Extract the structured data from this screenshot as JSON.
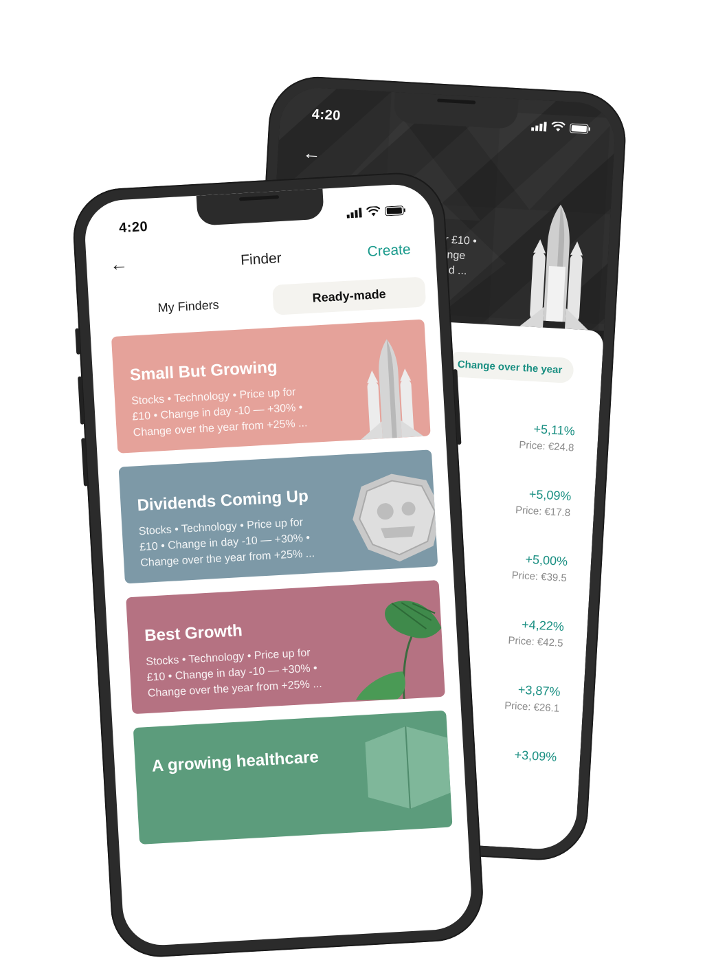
{
  "back_screen": {
    "time": "4:20",
    "partial_description_lines": [
      "for £10 •",
      "nange",
      "lend ..."
    ],
    "filter_chip_label": "Change over the year",
    "stocks": [
      {
        "change": "+5,11%",
        "price": "Price: €24.8"
      },
      {
        "change": "+5,09%",
        "price": "Price: €17.8"
      },
      {
        "change": "+5,00%",
        "price": "Price: €39.5"
      },
      {
        "change": "+4,22%",
        "price": "Price: €42.5"
      },
      {
        "change": "+3,87%",
        "price": "Price: €26.1"
      },
      {
        "change": "+3,09%",
        "price": ""
      }
    ]
  },
  "front_screen": {
    "time": "4:20",
    "header": {
      "title": "Finder",
      "create_label": "Create"
    },
    "tabs": [
      {
        "label": "My Finders",
        "active": false
      },
      {
        "label": "Ready-made",
        "active": true
      }
    ],
    "cards": [
      {
        "title": "Small But Growing",
        "lines": [
          "Stocks • Technology • Price up for",
          "£10 • Change in day -10 — +30% •",
          "Change over the year from +25% ..."
        ],
        "color": "#e5a29a",
        "art": "rocket"
      },
      {
        "title": "Dividends Coming Up",
        "lines": [
          "Stocks • Technology • Price up for",
          "£10 • Change in day -10 — +30% •",
          "Change over the year from +25% ..."
        ],
        "color": "#7d99a7",
        "art": "coin"
      },
      {
        "title": "Best Growth",
        "lines": [
          "Stocks • Technology • Price up for",
          "£10 • Change in day -10 — +30% •",
          "Change over the year from +25% ..."
        ],
        "color": "#b57282",
        "art": "plant"
      },
      {
        "title": "A growing healthcare",
        "lines": [],
        "color": "#5c9c7c",
        "art": "box"
      }
    ]
  },
  "colors": {
    "accent": "#1a9a8c",
    "phone_frame": "#2b2b2b",
    "back_screen_bg": "#1f1f1f"
  }
}
